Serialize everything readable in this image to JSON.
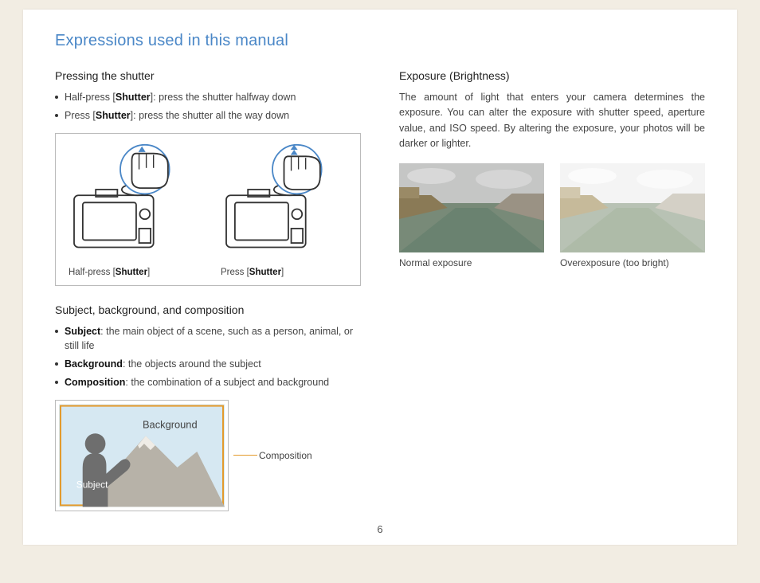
{
  "title": "Expressions used in this manual",
  "left": {
    "shutter": {
      "heading": "Pressing the shutter",
      "items": [
        {
          "prefix": "Half-press [",
          "bold": "Shutter",
          "suffix": "]: press the shutter halfway down"
        },
        {
          "prefix": "Press [",
          "bold": "Shutter",
          "suffix": "]: press the shutter all the way down"
        }
      ],
      "caption1_pre": "Half-press [",
      "caption1_bold": "Shutter",
      "caption1_post": "]",
      "caption2_pre": "Press [",
      "caption2_bold": "Shutter",
      "caption2_post": "]"
    },
    "subject": {
      "heading": "Subject, background, and composition",
      "items": [
        {
          "bold": "Subject",
          "text": ": the main object of a scene, such as a person, animal, or still life"
        },
        {
          "bold": "Background",
          "text": ": the objects around the subject"
        },
        {
          "bold": "Composition",
          "text": ": the combination of a subject and background"
        }
      ],
      "fig": {
        "subject": "Subject",
        "background": "Background",
        "composition": "Composition"
      }
    }
  },
  "right": {
    "exposure": {
      "heading": "Exposure (Brightness)",
      "body": "The amount of light that enters your camera determines the exposure. You can alter the exposure with shutter speed, aperture value, and ISO speed. By altering the exposure, your photos will be darker or lighter.",
      "caption_normal": "Normal exposure",
      "caption_over": "Overexposure (too bright)"
    }
  },
  "page_number": "6"
}
